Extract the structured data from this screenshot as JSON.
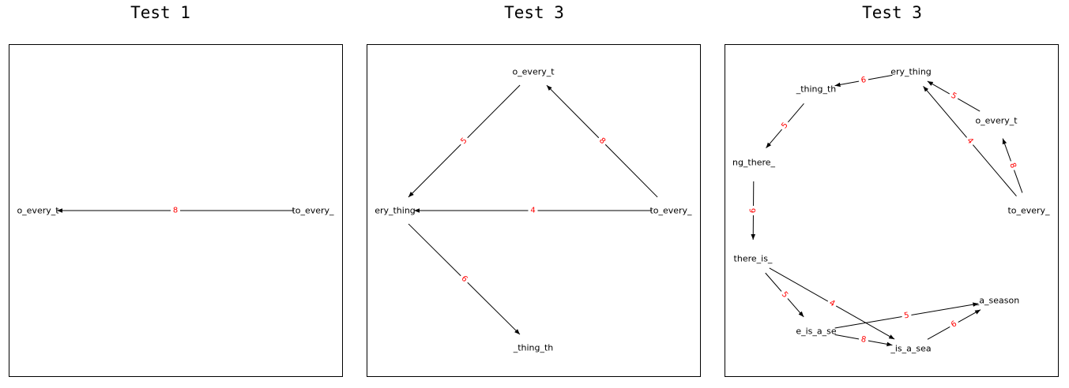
{
  "panels": [
    {
      "title": "Test 1",
      "nodes": [
        {
          "id": "o_every_t",
          "label": "o_every_t"
        },
        {
          "id": "to_every_",
          "label": "to_every_"
        }
      ],
      "edges": [
        {
          "from": "to_every_",
          "to": "o_every_t",
          "weight": "8"
        }
      ]
    },
    {
      "title": "Test 3",
      "nodes": [
        {
          "id": "o_every_t",
          "label": "o_every_t"
        },
        {
          "id": "ery_thing",
          "label": "ery_thing"
        },
        {
          "id": "to_every_",
          "label": "to_every_"
        },
        {
          "id": "_thing_th",
          "label": "_thing_th"
        }
      ],
      "edges": [
        {
          "from": "o_every_t",
          "to": "ery_thing",
          "weight": "5"
        },
        {
          "from": "to_every_",
          "to": "o_every_t",
          "weight": "8"
        },
        {
          "from": "to_every_",
          "to": "ery_thing",
          "weight": "4"
        },
        {
          "from": "ery_thing",
          "to": "_thing_th",
          "weight": "6"
        }
      ]
    },
    {
      "title": "Test 3",
      "nodes": [
        {
          "id": "ery_thing",
          "label": "ery_thing"
        },
        {
          "id": "_thing_th",
          "label": "_thing_th"
        },
        {
          "id": "o_every_t",
          "label": "o_every_t"
        },
        {
          "id": "ng_there_",
          "label": "ng_there_"
        },
        {
          "id": "to_every_",
          "label": "to_every_"
        },
        {
          "id": "there_is_",
          "label": "there_is_"
        },
        {
          "id": "_a_season",
          "label": "_a_season"
        },
        {
          "id": "e_is_a_se",
          "label": "e_is_a_se"
        },
        {
          "id": "_is_a_sea",
          "label": "_is_a_sea"
        }
      ],
      "edges": [
        {
          "from": "ery_thing",
          "to": "_thing_th",
          "weight": "6"
        },
        {
          "from": "o_every_t",
          "to": "ery_thing",
          "weight": "5"
        },
        {
          "from": "_thing_th",
          "to": "ng_there_",
          "weight": "5"
        },
        {
          "from": "to_every_",
          "to": "ery_thing",
          "weight": "4"
        },
        {
          "from": "to_every_",
          "to": "o_every_t",
          "weight": "8"
        },
        {
          "from": "ng_there_",
          "to": "there_is_",
          "weight": "6"
        },
        {
          "from": "there_is_",
          "to": "e_is_a_se",
          "weight": "5"
        },
        {
          "from": "there_is_",
          "to": "_is_a_sea",
          "weight": "4"
        },
        {
          "from": "e_is_a_se",
          "to": "_a_season",
          "weight": "5"
        },
        {
          "from": "e_is_a_se",
          "to": "_is_a_sea",
          "weight": "8"
        },
        {
          "from": "_is_a_sea",
          "to": "_a_season",
          "weight": "6"
        }
      ]
    }
  ],
  "colors": {
    "edge": "#000000",
    "weight": "#ff0000",
    "node_text": "#000000"
  }
}
